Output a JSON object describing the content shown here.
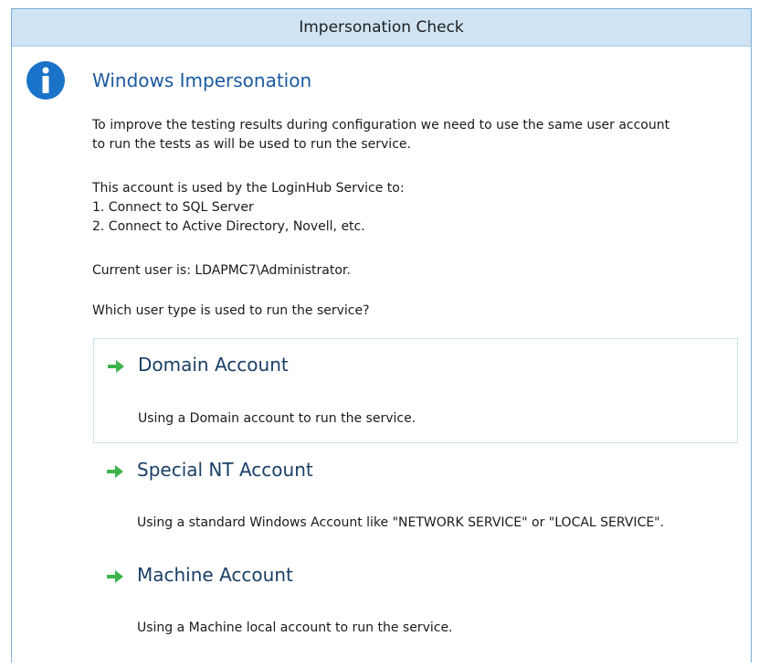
{
  "dialog": {
    "title": "Impersonation Check"
  },
  "section": {
    "heading": "Windows Impersonation",
    "intro_line1": "To improve the testing results during configuration we need to use the same user account",
    "intro_line2": "to run the tests as will be used to run the service.",
    "account_line1": "This account is used by the LoginHub Service to:",
    "account_line2": "1. Connect to SQL Server",
    "account_line3": "2. Connect to Active Directory, Novell, etc.",
    "current_user": "Current user is: LDAPMC7\\Administrator.",
    "question": "Which user type is used to run the service?"
  },
  "options": [
    {
      "title": "Domain Account",
      "description": "Using a Domain account to run the service."
    },
    {
      "title": "Special NT Account",
      "description": "Using a standard Windows Account like \"NETWORK SERVICE\" or \"LOCAL SERVICE\"."
    },
    {
      "title": "Machine Account",
      "description": "Using a Machine local account to run the service."
    }
  ],
  "icons": {
    "info": "info-icon",
    "arrow": "green-arrow-icon"
  },
  "colors": {
    "titlebar_bg": "#cfe3f3",
    "heading": "#1a5aa0",
    "info_icon": "#1a73c8",
    "arrow": "#3cb44b",
    "selected_border": "#c7e4f1"
  }
}
